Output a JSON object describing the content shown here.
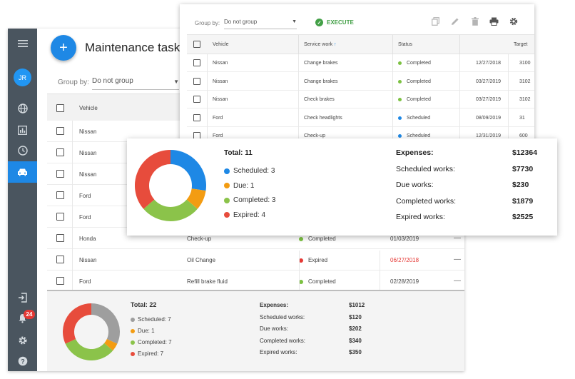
{
  "app": {
    "title": "Maintenance tasks",
    "fab_label": "+",
    "avatar_initials": "JR",
    "notifications_count": "24",
    "group_by_label": "Group by:",
    "group_by_value": "Do not group",
    "columns": {
      "vehicle": "Vehicle"
    },
    "rows": [
      {
        "vehicle": "Nissan",
        "service": "",
        "status": "",
        "status_color": "",
        "date": "",
        "date_color": ""
      },
      {
        "vehicle": "Nissan",
        "service": "",
        "status": "",
        "status_color": "",
        "date": "",
        "date_color": ""
      },
      {
        "vehicle": "Nissan",
        "service": "",
        "status": "",
        "status_color": "",
        "date": "",
        "date_color": ""
      },
      {
        "vehicle": "Ford",
        "service": "",
        "status": "",
        "status_color": "",
        "date": "",
        "date_color": ""
      },
      {
        "vehicle": "Ford",
        "service": "",
        "status": "",
        "status_color": "",
        "date": "",
        "date_color": ""
      },
      {
        "vehicle": "Honda",
        "service": "Check-up",
        "status": "Completed",
        "status_color": "#7cc142",
        "date": "01/03/2019",
        "date_color": "#444444"
      },
      {
        "vehicle": "Nissan",
        "service": "Oil Change",
        "status": "Expired",
        "status_color": "#e53935",
        "date": "06/27/2018",
        "date_color": "#e53935"
      },
      {
        "vehicle": "Ford",
        "service": "Refill brake fluid",
        "status": "Completed",
        "status_color": "#7cc142",
        "date": "02/28/2019",
        "date_color": "#444444"
      }
    ],
    "row_dash": "—",
    "summary": {
      "total": "Total: 22",
      "legend": [
        {
          "label": "Scheduled: 7",
          "color": "#9e9e9e"
        },
        {
          "label": "Due: 1",
          "color": "#f39c12"
        },
        {
          "label": "Completed: 7",
          "color": "#8bc34a"
        },
        {
          "label": "Expired: 7",
          "color": "#e74c3c"
        }
      ],
      "expenses": [
        {
          "label": "Expenses:",
          "value": "$1012"
        },
        {
          "label": "Scheduled works:",
          "value": "$120"
        },
        {
          "label": "Due works:",
          "value": "$202"
        },
        {
          "label": "Completed works:",
          "value": "$340"
        },
        {
          "label": "Expired works:",
          "value": "$350"
        }
      ],
      "donut": [
        7,
        1,
        7,
        7
      ]
    }
  },
  "window2": {
    "group_by_label": "Group by:",
    "group_by_value": "Do not group",
    "execute_label": "EXECUTE",
    "columns": {
      "vehicle": "Vehicle",
      "service": "Service work",
      "status": "Status",
      "target": "Target"
    },
    "rows": [
      {
        "vehicle": "Nissan",
        "service": "Change brakes",
        "status": "Completed",
        "status_color": "#7cc142",
        "date": "12/27/2018",
        "target": "3100"
      },
      {
        "vehicle": "Nissan",
        "service": "Change brakes",
        "status": "Completed",
        "status_color": "#7cc142",
        "date": "03/27/2019",
        "target": "3102"
      },
      {
        "vehicle": "Nissan",
        "service": "Check brakes",
        "status": "Completed",
        "status_color": "#7cc142",
        "date": "03/27/2019",
        "target": "3102"
      },
      {
        "vehicle": "Ford",
        "service": "Check headlights",
        "status": "Scheduled",
        "status_color": "#1e88e5",
        "date": "08/09/2019",
        "target": "31"
      },
      {
        "vehicle": "Ford",
        "service": "Check-up",
        "status": "Scheduled",
        "status_color": "#1e88e5",
        "date": "12/31/2019",
        "target": "600"
      }
    ]
  },
  "overlay": {
    "total": "Total: 11",
    "legend": [
      {
        "label": "Scheduled: 3",
        "color": "#1e88e5"
      },
      {
        "label": "Due: 1",
        "color": "#f39c12"
      },
      {
        "label": "Completed: 3",
        "color": "#8bc34a"
      },
      {
        "label": "Expired: 4",
        "color": "#e74c3c"
      }
    ],
    "expenses": [
      {
        "label": "Expenses:",
        "value": "$12364"
      },
      {
        "label": "Scheduled works:",
        "value": "$7730"
      },
      {
        "label": "Due works:",
        "value": "$230"
      },
      {
        "label": "Completed works:",
        "value": "$1879"
      },
      {
        "label": "Expired works:",
        "value": "$2525"
      }
    ],
    "donut": [
      3,
      1,
      3,
      4
    ]
  }
}
